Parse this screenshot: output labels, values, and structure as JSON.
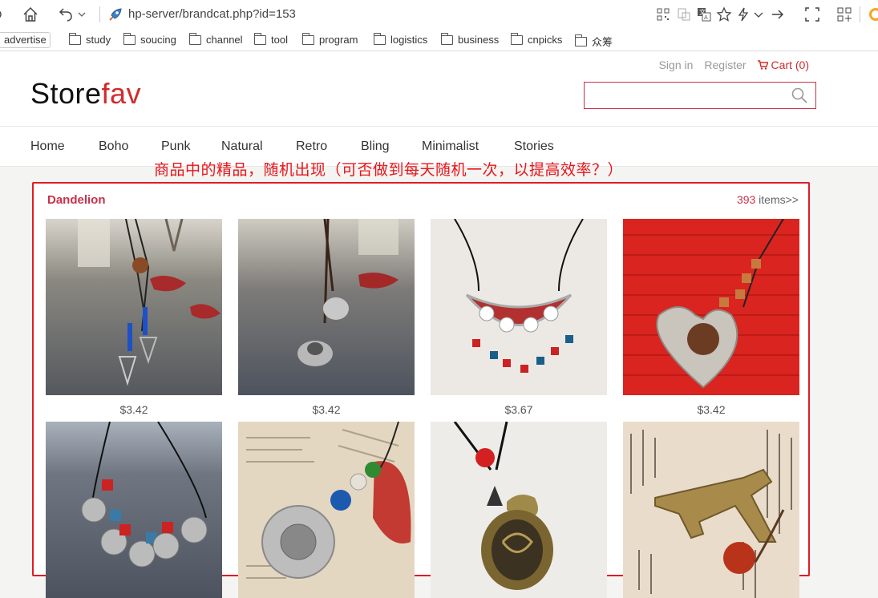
{
  "browser": {
    "url": "hp-server/brandcat.php?id=153",
    "bookmarks": [
      "advertise",
      "study",
      "soucing",
      "channel",
      "tool",
      "program",
      "logistics",
      "business",
      "cnpicks",
      "众筹"
    ]
  },
  "header": {
    "logo_part1": "Store",
    "logo_part2": "fav",
    "sign_in": "Sign in",
    "register": "Register",
    "cart": "Cart (0)",
    "search_placeholder": ""
  },
  "nav": [
    "Home",
    "Boho",
    "Punk",
    "Natural",
    "Retro",
    "Bling",
    "Minimalist",
    "Stories"
  ],
  "annotation": "商品中的精品，随机出现（可否做到每天随机一次，以提高效率？）",
  "section": {
    "title": "Dandelion",
    "count": "393",
    "count_suffix": " items>>"
  },
  "products": [
    {
      "price": "$3.42",
      "image": "necklace-silver-diamond-pendants"
    },
    {
      "price": "$3.42",
      "image": "necklace-silver-flower-bud"
    },
    {
      "price": "$3.67",
      "image": "necklace-enamel-crescent-tassel"
    },
    {
      "price": "$3.42",
      "image": "necklace-heart-teddy-bear"
    },
    {
      "price": "",
      "image": "necklace-silver-beads-cubes"
    },
    {
      "price": "",
      "image": "necklace-sunflower-leaf"
    },
    {
      "price": "",
      "image": "necklace-bronze-cage-pendant"
    },
    {
      "price": "",
      "image": "necklace-bronze-airplane"
    }
  ],
  "colors": {
    "brand_red": "#d02b2b",
    "annotation_red": "#e8151b",
    "panel_border": "#e01b24"
  }
}
